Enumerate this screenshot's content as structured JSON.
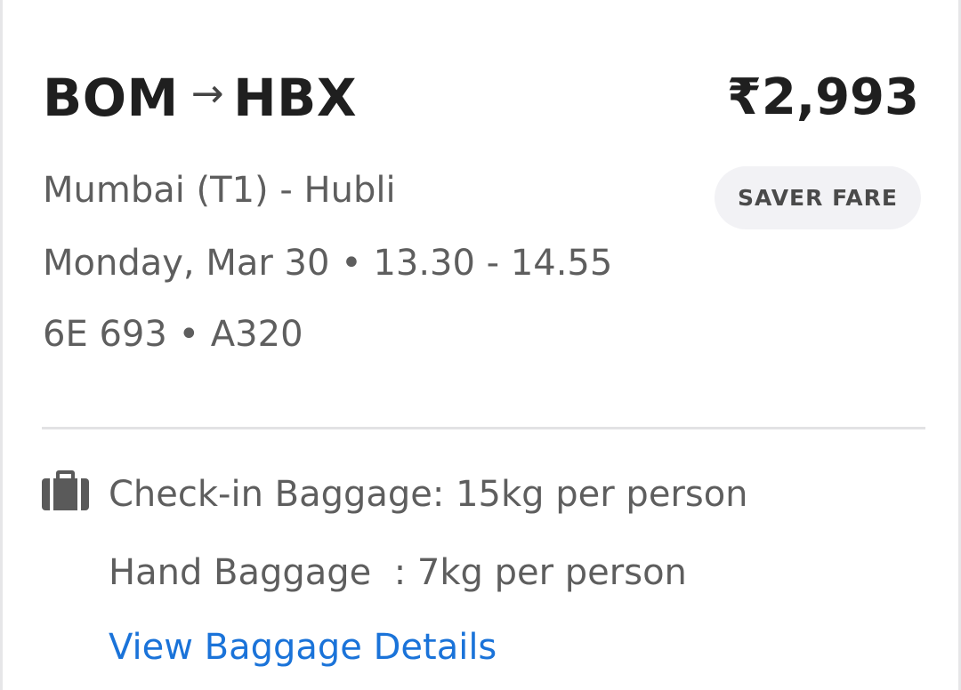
{
  "flight": {
    "origin": "BOM",
    "arrow": "→",
    "destination": "HBX",
    "price": "₹2,993",
    "fare_type": "SAVER FARE",
    "cities": "Mumbai (T1) - Hubli",
    "datetime": "Monday, Mar 30 • 13.30 - 14.55",
    "flight_info": "6E 693 • A320"
  },
  "baggage": {
    "icon": "briefcase-icon",
    "checkin": "Check-in Baggage: 15kg per person",
    "hand": "Hand Baggage  : 7kg per person",
    "view_link": "View Baggage Details"
  },
  "colors": {
    "link": "#1a73d9",
    "title": "#1f1f1f",
    "secondary_text": "#5e5e5e",
    "badge_bg": "#f2f2f5"
  }
}
